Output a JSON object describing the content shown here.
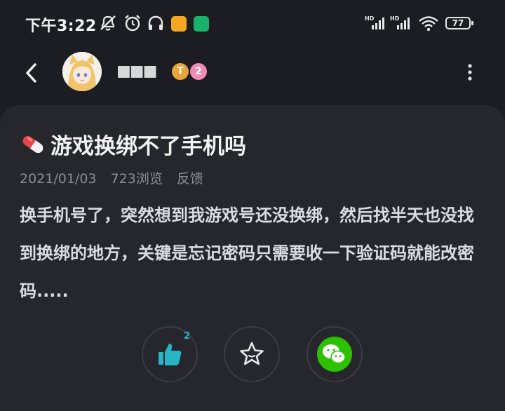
{
  "status_bar": {
    "time": "下午3:22",
    "battery": "77",
    "network_labels": [
      "HD",
      "HD"
    ]
  },
  "header": {
    "username_masked": "■■■",
    "level_badge": "T",
    "count_badge": "2"
  },
  "post": {
    "title": "游戏换绑不了手机吗",
    "date": "2021/01/03",
    "views": "723浏览",
    "feedback": "反馈",
    "body": "换手机号了，突然想到我游戏号还没换绑，然后找半天也没找到换绑的地方，关键是忘记密码只需要收一下验证码就能改密码.....",
    "like_count": "2"
  },
  "icons": [
    "back-icon",
    "avatar",
    "more-icon",
    "pill-icon",
    "thumbs-up-icon",
    "star-icon",
    "wechat-icon",
    "mute-icon",
    "alarm-icon",
    "headphones-icon",
    "wifi-icon",
    "battery-icon"
  ],
  "colors": {
    "background": "#1c1d22",
    "card": "#26272d",
    "accent": "#27b6c4",
    "wechat": "#2dc100"
  }
}
